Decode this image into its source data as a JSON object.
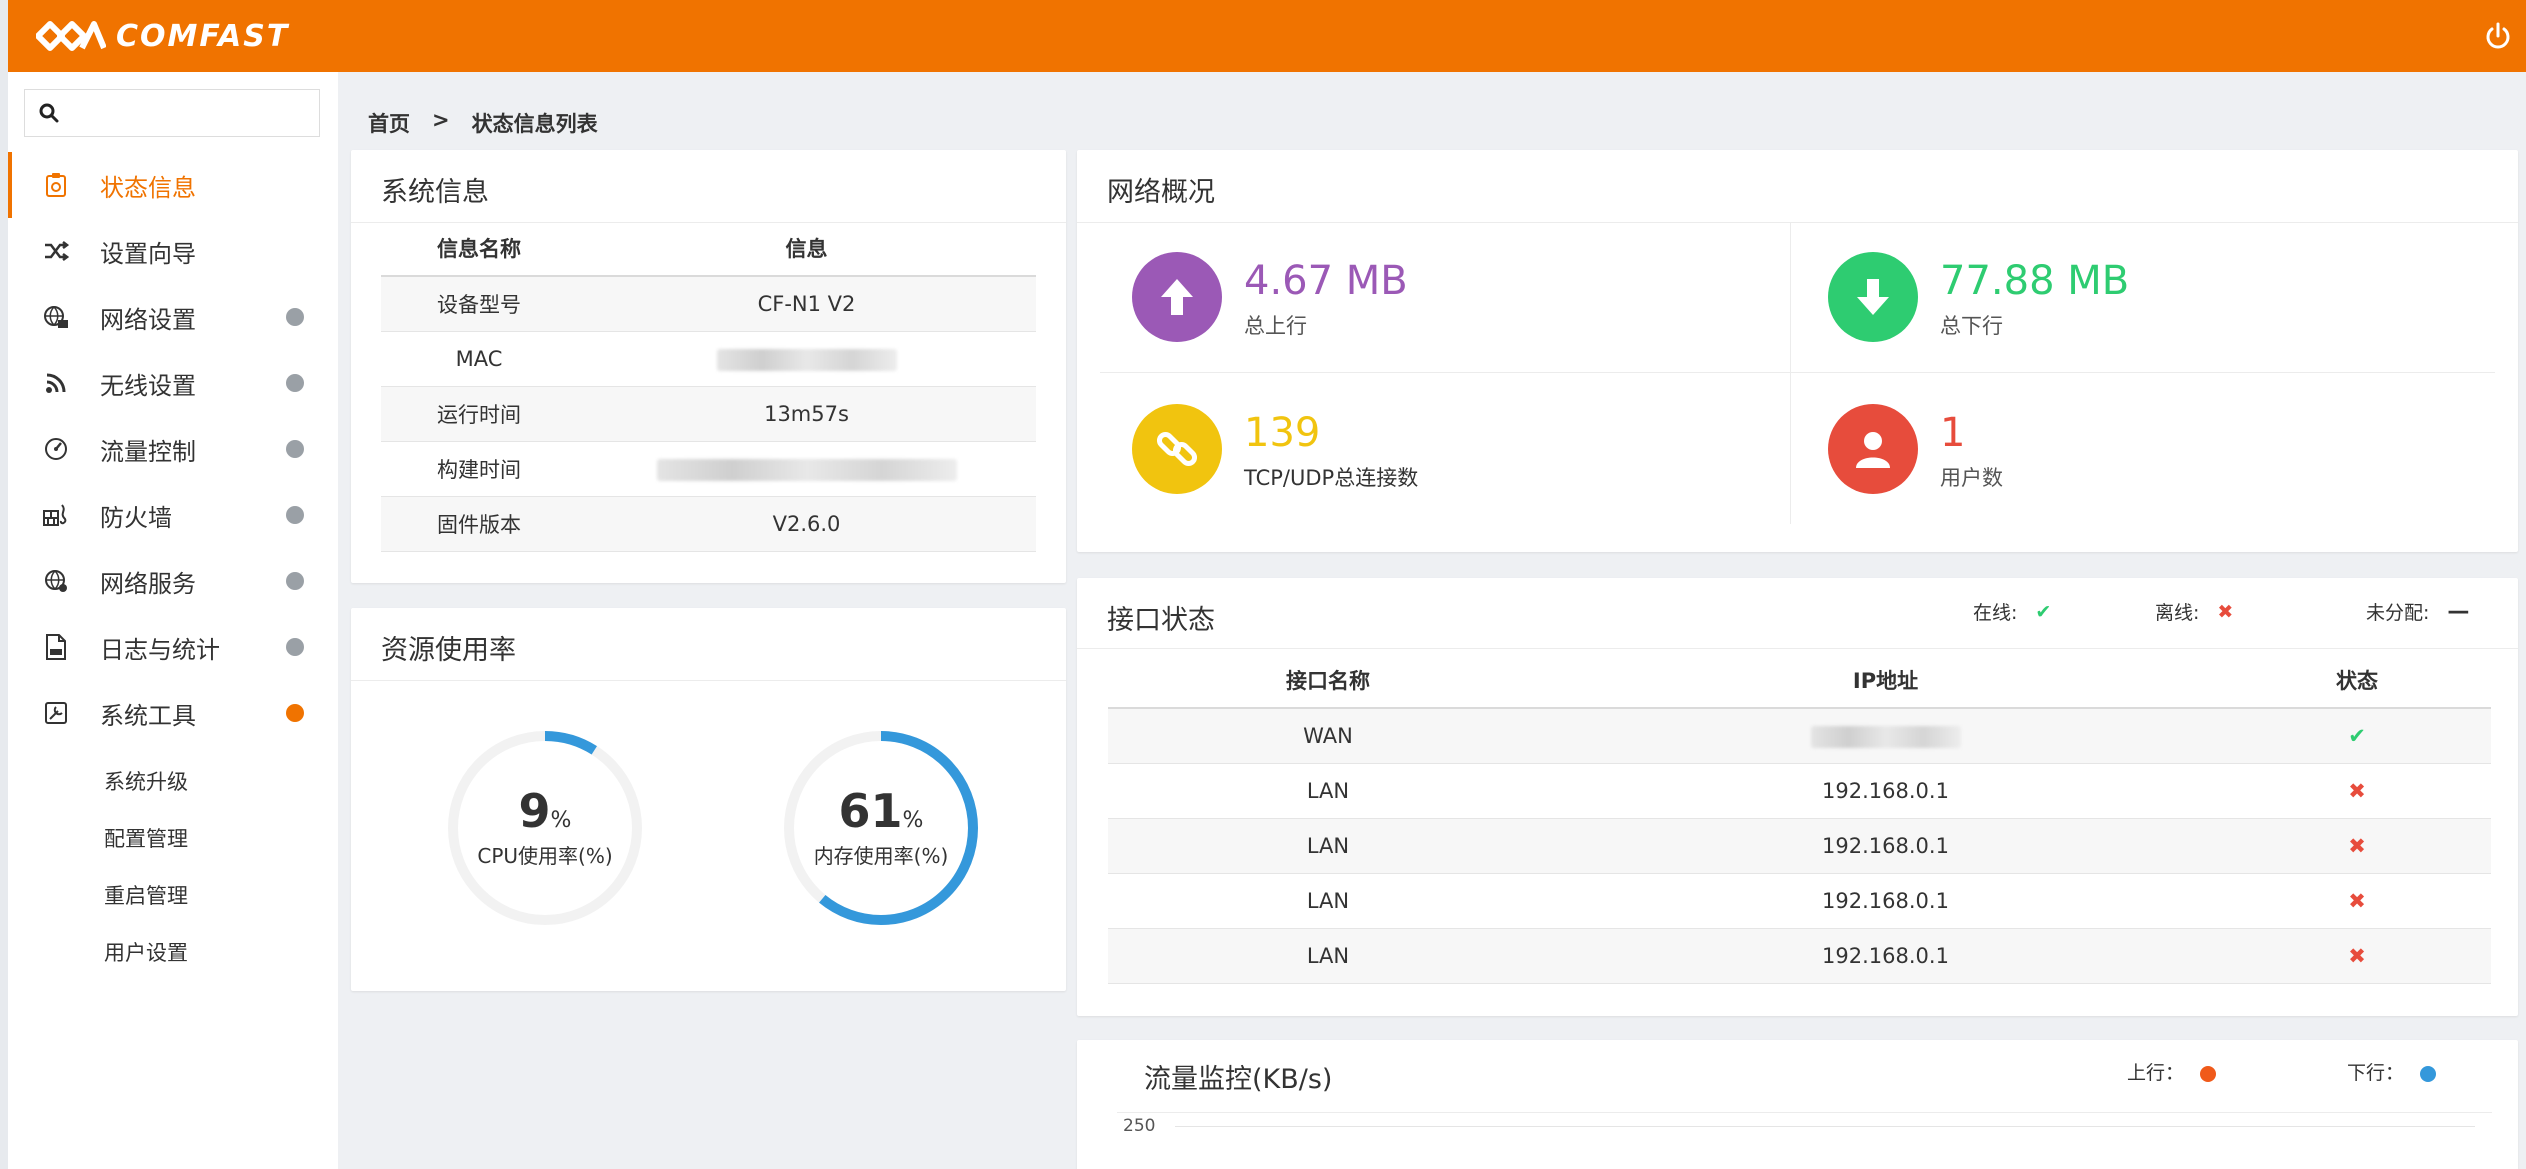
{
  "header": {
    "brand": "COMFAST"
  },
  "sidebar": {
    "search_placeholder": "",
    "items": [
      {
        "label": "状态信息"
      },
      {
        "label": "设置向导"
      },
      {
        "label": "网络设置"
      },
      {
        "label": "无线设置"
      },
      {
        "label": "流量控制"
      },
      {
        "label": "防火墙"
      },
      {
        "label": "网络服务"
      },
      {
        "label": "日志与统计"
      },
      {
        "label": "系统工具"
      }
    ],
    "subitems": [
      {
        "label": "系统升级"
      },
      {
        "label": "配置管理"
      },
      {
        "label": "重启管理"
      },
      {
        "label": "用户设置"
      }
    ]
  },
  "breadcrumb": {
    "home": "首页",
    "sep": ">",
    "current": "状态信息列表"
  },
  "system_info": {
    "title": "系统信息",
    "headers": [
      "信息名称",
      "信息"
    ],
    "rows": [
      {
        "name": "设备型号",
        "value": "CF-N1 V2"
      },
      {
        "name": "MAC",
        "value": ""
      },
      {
        "name": "运行时间",
        "value": "13m57s"
      },
      {
        "name": "构建时间",
        "value": ""
      },
      {
        "name": "固件版本",
        "value": "V2.6.0"
      }
    ]
  },
  "resources": {
    "title": "资源使用率",
    "cpu": {
      "value": "9",
      "unit": "%",
      "label": "CPU使用率(%)",
      "percent": 9
    },
    "mem": {
      "value": "61",
      "unit": "%",
      "label": "内存使用率(%)",
      "percent": 61
    }
  },
  "network": {
    "title": "网络概况",
    "upload": {
      "value": "4.67 MB",
      "label": "总上行",
      "color": "#9b59b6"
    },
    "download": {
      "value": "77.88 MB",
      "label": "总下行",
      "color": "#2ecc71"
    },
    "connections": {
      "value": "139",
      "label": "TCP/UDP总连接数",
      "color": "#f1c40f"
    },
    "users": {
      "value": "1",
      "label": "用户数",
      "color": "#e74c3c"
    }
  },
  "interfaces": {
    "title": "接口状态",
    "legend": {
      "online": "在线:",
      "offline": "离线:",
      "unassigned": "未分配:"
    },
    "headers": [
      "接口名称",
      "IP地址",
      "状态"
    ],
    "rows": [
      {
        "name": "WAN",
        "ip": "",
        "status": "online"
      },
      {
        "name": "LAN",
        "ip": "192.168.0.1",
        "status": "offline"
      },
      {
        "name": "LAN",
        "ip": "192.168.0.1",
        "status": "offline"
      },
      {
        "name": "LAN",
        "ip": "192.168.0.1",
        "status": "offline"
      },
      {
        "name": "LAN",
        "ip": "192.168.0.1",
        "status": "offline"
      }
    ]
  },
  "traffic": {
    "title": "流量监控(KB/s)",
    "legend_up": "上行：",
    "legend_down": "下行：",
    "up_color": "#f05a1a",
    "down_color": "#3498db",
    "y_tick": "250"
  },
  "colors": {
    "accent": "#f07300",
    "gauge": "#3498db"
  }
}
